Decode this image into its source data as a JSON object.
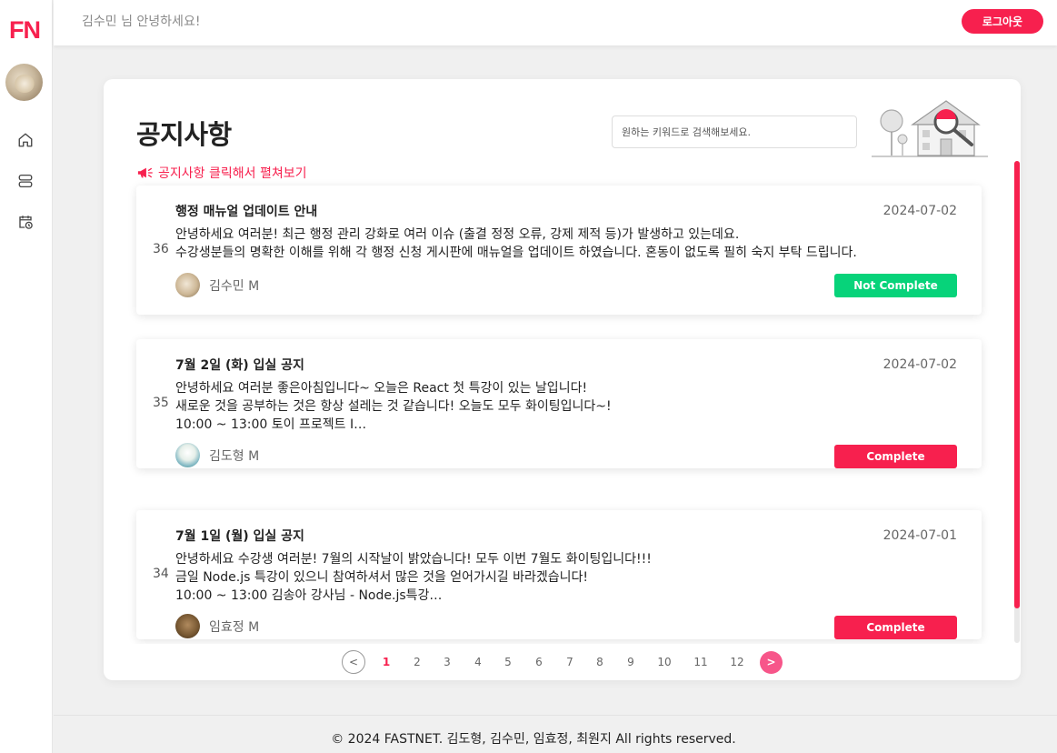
{
  "brand": {
    "logo": "FN",
    "accent": "#f7204e"
  },
  "header": {
    "greeting": "김수민 님 안녕하세요!",
    "logout_label": "로그아웃"
  },
  "sidebar": {
    "items": [
      {
        "icon": "home-icon"
      },
      {
        "icon": "list-icon"
      },
      {
        "icon": "calendar-clock-icon"
      }
    ]
  },
  "page": {
    "title": "공지사항",
    "hint": "공지사항 클릭해서 펼쳐보기",
    "search_placeholder": "원하는 키워드로 검색해보세요."
  },
  "posts": [
    {
      "number": "36",
      "title": "행정 매뉴얼 업데이트 안내",
      "date": "2024-07-02",
      "body": "안녕하세요 여러분! 최근 행정 관리 강화로 여러 이슈 (출결 정정 오류, 강제 제적 등)가 발생하고 있는데요.\n수강생분들의 명확한 이해를 위해 각 행정 신청 게시판에 매뉴얼을 업데이트 하였습니다. 혼동이 없도록 필히 숙지 부탁 드립니다.",
      "author": "김수민 M",
      "status": "Not Complete",
      "status_color": "#07d37a"
    },
    {
      "number": "35",
      "title": "7월 2일 (화) 입실 공지",
      "date": "2024-07-02",
      "body": "안녕하세요 여러분 좋은아침입니다~ 오늘은 React 첫 특강이 있는 날입니다!\n새로운 것을 공부하는 것은 항상 설레는 것 같습니다! 오늘도 모두 화이팅입니다~!\n10:00 ~ 13:00 토이 프로젝트 I…",
      "author": "김도형 M",
      "status": "Complete",
      "status_color": "#f7204e"
    },
    {
      "number": "34",
      "title": "7월 1일 (월) 입실 공지",
      "date": "2024-07-01",
      "body": "안녕하세요 수강생 여러분! 7월의 시작날이 밝았습니다! 모두 이번 7월도 화이팅입니다!!!\n금일 Node.js 특강이 있으니 참여하셔서 많은 것을 얻어가시길 바라겠습니다!\n10:00 ~ 13:00 김송아 강사님 - Node.js특강…",
      "author": "임효정 M",
      "status": "Complete",
      "status_color": "#f7204e"
    }
  ],
  "pagination": {
    "prev": "<",
    "next": ">",
    "pages": [
      "1",
      "2",
      "3",
      "4",
      "5",
      "6",
      "7",
      "8",
      "9",
      "10",
      "11",
      "12"
    ],
    "current": "1"
  },
  "footer": {
    "text": "© 2024 FASTNET. 김도형, 김수민, 임효정, 최원지 All rights reserved."
  }
}
